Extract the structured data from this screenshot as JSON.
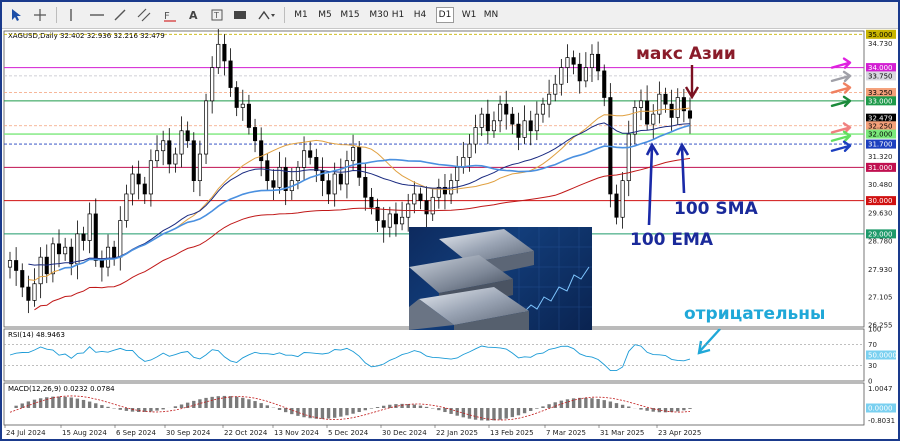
{
  "toolbar": {
    "timeframes": [
      "M1",
      "M5",
      "M15",
      "M30",
      "H1",
      "H4",
      "D1",
      "W1",
      "MN"
    ],
    "active_timeframe": "D1",
    "tools": [
      "cursor-icon",
      "crosshair-icon",
      "vertical-line-icon",
      "horizontal-line-icon",
      "trendline-icon",
      "channel-icon",
      "fibonacci-icon",
      "text-icon",
      "label-icon",
      "shapes-icon"
    ]
  },
  "symbol_info": "XAGUSD,Daily  32.402 32.936 32.216 32.479",
  "price_axis": {
    "ticks": [
      "34.730",
      "31.320",
      "30.480",
      "29.630",
      "28.780",
      "27.930",
      "27.105",
      "26.255"
    ],
    "labels": [
      {
        "text": "35.000",
        "color": "#c8b400"
      },
      {
        "text": "34.000",
        "color": "#d21ed2"
      },
      {
        "text": "33.750",
        "color": "#d8d8e0"
      },
      {
        "text": "33.250",
        "color": "#f4a07a"
      },
      {
        "text": "33.000",
        "color": "#1e9a4a"
      },
      {
        "text": "32.479",
        "color": "#000000"
      },
      {
        "text": "32.250",
        "color": "#f4a07a"
      },
      {
        "text": "32.000",
        "color": "#7ae87a"
      },
      {
        "text": "31.700",
        "color": "#1c3fbf"
      },
      {
        "text": "31.000",
        "color": "#c01050"
      },
      {
        "text": "30.000",
        "color": "#d01010"
      },
      {
        "text": "29.000",
        "color": "#1e9a6a"
      }
    ]
  },
  "annotations": {
    "asia_max": "макс Азии",
    "sma100": "100 SMA",
    "ema100": "100 EMA",
    "negative": "отрицательны"
  },
  "rsi": {
    "label": "RSI(14) 48.9463",
    "ticks": [
      "100",
      "70",
      "30",
      "0"
    ],
    "current": "50.0000"
  },
  "macd": {
    "label": "MACD(12,26,9) 0.0232 0.0784",
    "ticks": [
      "1.0047",
      "-0.8031"
    ],
    "current": "0.0000"
  },
  "time_axis": [
    "24 Jul 2024",
    "15 Aug 2024",
    "6 Sep 2024",
    "30 Sep 2024",
    "22 Oct 2024",
    "13 Nov 2024",
    "5 Dec 2024",
    "30 Dec 2024",
    "22 Jan 2025",
    "13 Feb 2025",
    "7 Mar 2025",
    "31 Mar 2025",
    "23 Apr 2025"
  ],
  "chart_data": {
    "type": "candlestick",
    "symbol": "XAGUSD",
    "timeframe": "Daily",
    "last": {
      "open": 32.402,
      "high": 32.936,
      "low": 32.216,
      "close": 32.479
    },
    "price_range": [
      26.2,
      35.1
    ],
    "close_path": [
      28.2,
      27.9,
      27.4,
      27.0,
      27.5,
      28.3,
      27.8,
      28.7,
      28.4,
      28.6,
      28.1,
      29.0,
      28.8,
      29.6,
      28.2,
      28.0,
      28.6,
      28.3,
      29.4,
      30.2,
      30.8,
      30.5,
      30.2,
      31.2,
      31.5,
      31.8,
      31.1,
      31.4,
      32.1,
      31.8,
      30.6,
      31.4,
      33.0,
      34.0,
      34.7,
      34.2,
      33.4,
      32.8,
      32.9,
      32.2,
      31.8,
      31.2,
      30.6,
      30.4,
      31.0,
      30.3,
      30.6,
      31.0,
      31.5,
      31.3,
      30.9,
      30.6,
      30.2,
      30.8,
      30.5,
      31.2,
      31.6,
      30.7,
      30.1,
      29.8,
      29.4,
      29.2,
      29.6,
      29.3,
      29.5,
      29.9,
      30.2,
      30.0,
      29.6,
      30.1,
      30.4,
      30.2,
      30.6,
      31.0,
      31.3,
      31.7,
      32.2,
      32.6,
      32.1,
      32.4,
      32.9,
      32.6,
      32.3,
      31.9,
      32.4,
      32.1,
      32.6,
      32.9,
      33.2,
      33.5,
      34.0,
      34.3,
      34.1,
      33.6,
      34.0,
      34.4,
      33.9,
      33.1,
      30.2,
      29.5,
      30.6,
      32.0,
      32.8,
      33.0,
      32.3,
      32.6,
      33.2,
      32.9,
      32.5,
      33.1,
      32.7,
      32.479
    ],
    "indicators": [
      "100 SMA",
      "100 EMA",
      "MA slow (red)",
      "MA fast (orange)"
    ]
  }
}
